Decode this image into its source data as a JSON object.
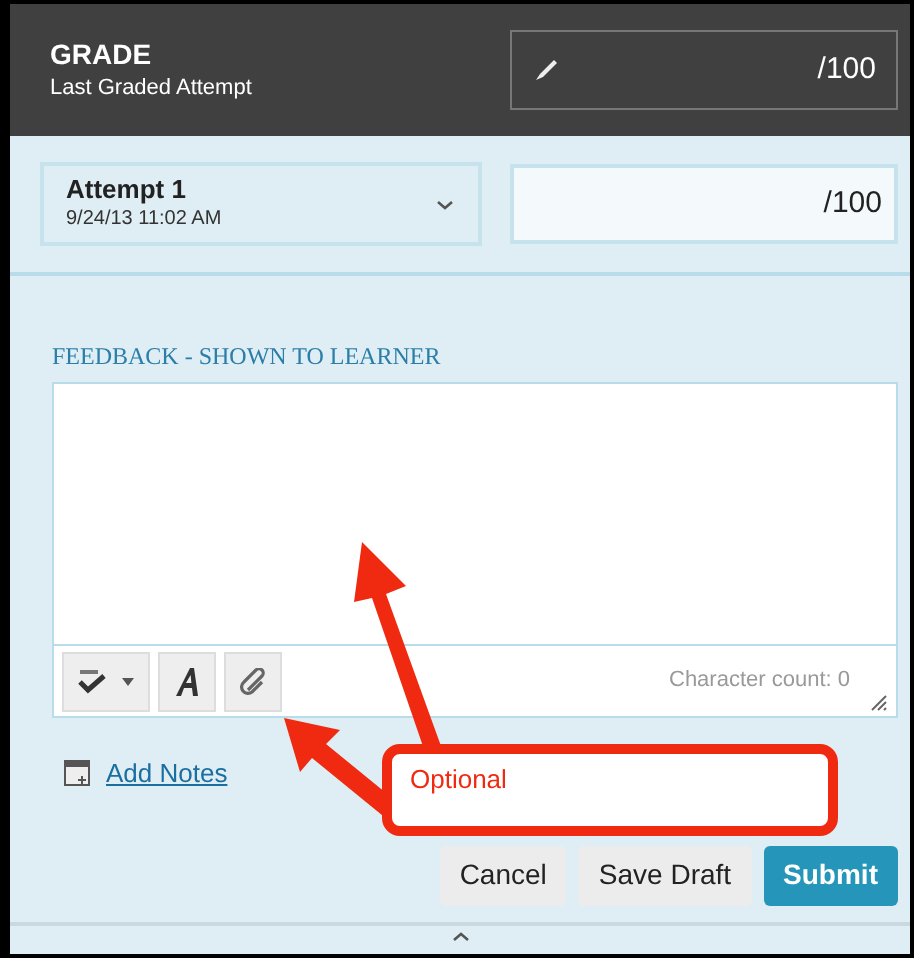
{
  "header": {
    "title": "GRADE",
    "subtitle": "Last Graded Attempt",
    "grade_suffix": "/100"
  },
  "attempt": {
    "label": "Attempt 1",
    "date": "9/24/13 11:02 AM",
    "score_suffix": "/100"
  },
  "feedback": {
    "label": "FEEDBACK - SHOWN TO LEARNER",
    "character_count": "Character count: 0"
  },
  "add_notes": "Add Notes",
  "annotation": {
    "text": "Optional"
  },
  "buttons": [
    {
      "label": "Cancel",
      "kind": "secondary"
    },
    {
      "label": "Save Draft",
      "kind": "secondary"
    },
    {
      "label": "Submit",
      "kind": "primary"
    }
  ]
}
